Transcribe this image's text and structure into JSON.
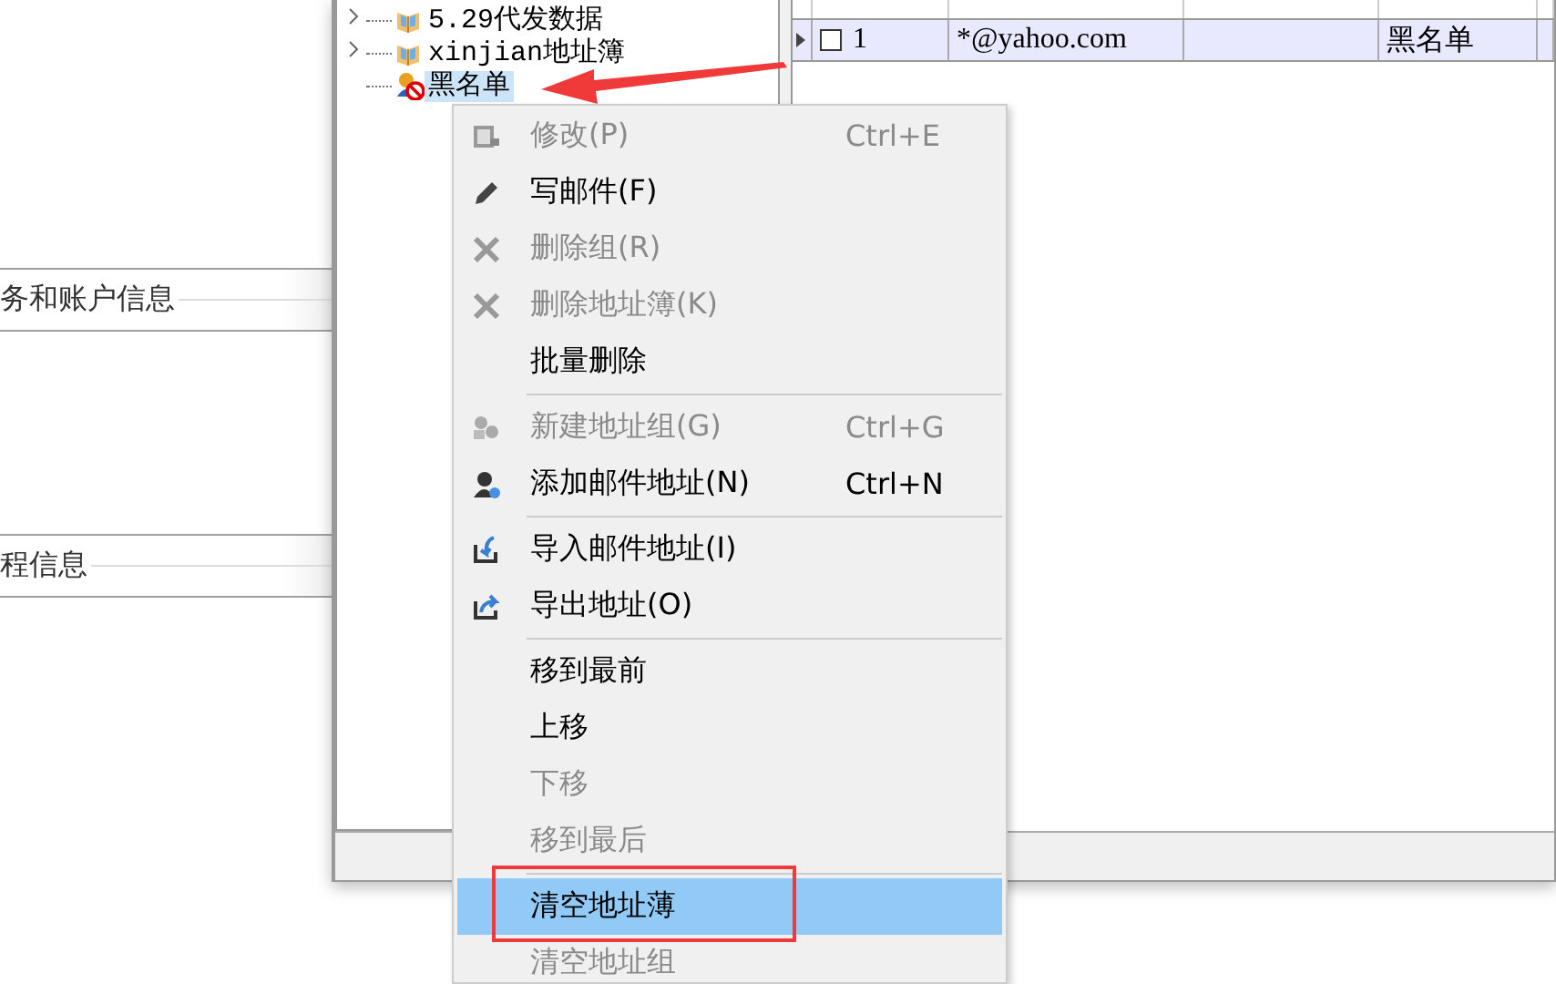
{
  "background_groups": [
    {
      "label": "务和账户信息"
    },
    {
      "label": "程信息"
    }
  ],
  "tree": {
    "items": [
      {
        "label": "5.29代发数据",
        "kind": "book",
        "expandable": true,
        "selected": false
      },
      {
        "label": "xinjian地址簿",
        "kind": "book",
        "expandable": true,
        "selected": false
      },
      {
        "label": "黑名单",
        "kind": "blocked",
        "expandable": false,
        "selected": true
      }
    ]
  },
  "grid": {
    "rows": [
      {
        "checked": false,
        "number": "1",
        "email": "*@yahoo.com",
        "column_3": "",
        "group": "黑名单"
      }
    ]
  },
  "context_menu": {
    "sections": [
      [
        {
          "label": "修改(P)",
          "shortcut": "Ctrl+E",
          "kind": "edit",
          "disabled": true,
          "selected": false
        },
        {
          "label": "写邮件(F)",
          "kind": "pencil",
          "disabled": false,
          "selected": false
        },
        {
          "label": "删除组(R)",
          "kind": "cross",
          "disabled": true,
          "selected": false
        },
        {
          "label": "删除地址簿(K)",
          "kind": "cross",
          "disabled": true,
          "selected": false
        },
        {
          "label": "批量删除",
          "kind": "plain",
          "disabled": false,
          "selected": false
        }
      ],
      [
        {
          "label": "新建地址组(G)",
          "shortcut": "Ctrl+G",
          "kind": "group",
          "disabled": true,
          "selected": false
        },
        {
          "label": "添加邮件地址(N)",
          "shortcut": "Ctrl+N",
          "kind": "add-user",
          "disabled": false,
          "selected": false
        }
      ],
      [
        {
          "label": "导入邮件地址(I)",
          "kind": "import",
          "disabled": false,
          "selected": false
        },
        {
          "label": "导出地址(O)",
          "kind": "export",
          "disabled": false,
          "selected": false
        }
      ],
      [
        {
          "label": "移到最前",
          "kind": "plain",
          "disabled": false,
          "selected": false
        },
        {
          "label": "上移",
          "kind": "plain",
          "disabled": false,
          "selected": false
        },
        {
          "label": "下移",
          "kind": "plain",
          "disabled": true,
          "selected": false
        },
        {
          "label": "移到最后",
          "kind": "plain",
          "disabled": true,
          "selected": false
        }
      ],
      [
        {
          "label": "清空地址薄",
          "kind": "plain",
          "disabled": false,
          "selected": true
        },
        {
          "label": "清空地址组",
          "kind": "plain",
          "disabled": true,
          "selected": false
        }
      ]
    ]
  }
}
